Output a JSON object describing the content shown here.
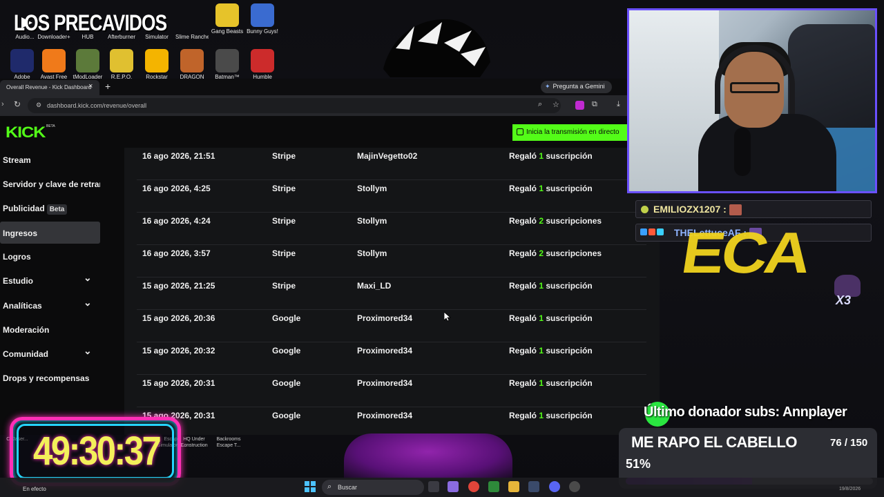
{
  "overlay": {
    "channel_name": "LOS PRECAVIDOS",
    "timer": "49:30:37",
    "donor_text": "Último donador subs: Annplayer",
    "goal": {
      "title": "ME RAPO EL CABELLO",
      "count": "76 / 150",
      "percent_text": "51%",
      "progress": 0.51
    },
    "stylized_text": "ECA",
    "x3_text": "X3"
  },
  "desktop_icons": [
    {
      "label": "Audio...",
      "color": "#2a5bd7"
    },
    {
      "label": "Downloader+",
      "color": "#39b54a"
    },
    {
      "label": "HUB",
      "color": "#3a3a3a"
    },
    {
      "label": "Afterburner",
      "color": "#6b1010"
    },
    {
      "label": "Simulator",
      "color": "#2a2a2a"
    },
    {
      "label": "Slime Rancher",
      "color": "#e64b7a"
    },
    {
      "label": "Gang Beasts",
      "color": "#e6c32a"
    },
    {
      "label": "Bunny Guys!",
      "color": "#3a6bd0"
    },
    {
      "label": "Adobe",
      "color": "#1f2a6b"
    },
    {
      "label": "Avast Free",
      "color": "#f07a1a"
    },
    {
      "label": "tModLoader",
      "color": "#5c7a3a"
    },
    {
      "label": "R.E.P.O.",
      "color": "#e0c030"
    },
    {
      "label": "Rockstar",
      "color": "#f4b400"
    },
    {
      "label": "DRAGON",
      "color": "#c0642a"
    },
    {
      "label": "Batman™",
      "color": "#4a4a4a"
    },
    {
      "label": "Humble",
      "color": "#cc2b2b"
    }
  ],
  "browser": {
    "tab_title": "Overall Revenue - Kick Dashboard",
    "gemini_label": "Pregunta a Gemini",
    "url": "dashboard.kick.com/revenue/overall"
  },
  "kick": {
    "logo": "KICK",
    "logo_sup": "BETA",
    "go_live_label": "Inicia la transmisión en directo"
  },
  "sidebar": {
    "items": [
      {
        "label": "Stream",
        "chevron": false,
        "active": false
      },
      {
        "label": "Servidor y clave de retransmisión",
        "chevron": false,
        "active": false
      },
      {
        "label": "Publicidad",
        "badge": "Beta",
        "chevron": false,
        "active": false
      },
      {
        "label": "Ingresos",
        "chevron": false,
        "active": true
      },
      {
        "label": "Logros",
        "chevron": false,
        "active": false
      },
      {
        "label": "Estudio",
        "chevron": true,
        "active": false
      },
      {
        "label": "Analíticas",
        "chevron": true,
        "active": false
      },
      {
        "label": "Moderación",
        "chevron": false,
        "active": false
      },
      {
        "label": "Comunidad",
        "chevron": true,
        "active": false
      },
      {
        "label": "Drops y recompensas",
        "chevron": false,
        "active": false
      }
    ]
  },
  "revenue_rows": [
    {
      "date": "16 ago 2026, 21:51",
      "method": "Stripe",
      "user": "MajinVegetto02",
      "action_prefix": "Regaló",
      "count": "1",
      "action_suffix": "suscripción"
    },
    {
      "date": "16 ago 2026, 4:25",
      "method": "Stripe",
      "user": "Stollym",
      "action_prefix": "Regaló",
      "count": "1",
      "action_suffix": "suscripción"
    },
    {
      "date": "16 ago 2026, 4:24",
      "method": "Stripe",
      "user": "Stollym",
      "action_prefix": "Regaló",
      "count": "2",
      "action_suffix": "suscripciones"
    },
    {
      "date": "16 ago 2026, 3:57",
      "method": "Stripe",
      "user": "Stollym",
      "action_prefix": "Regaló",
      "count": "2",
      "action_suffix": "suscripciones"
    },
    {
      "date": "15 ago 2026, 21:25",
      "method": "Stripe",
      "user": "Maxi_LD",
      "action_prefix": "Regaló",
      "count": "1",
      "action_suffix": "suscripción"
    },
    {
      "date": "15 ago 2026, 20:36",
      "method": "Google",
      "user": "Proximored34",
      "action_prefix": "Regaló",
      "count": "1",
      "action_suffix": "suscripción"
    },
    {
      "date": "15 ago 2026, 20:32",
      "method": "Google",
      "user": "Proximored34",
      "action_prefix": "Regaló",
      "count": "1",
      "action_suffix": "suscripción"
    },
    {
      "date": "15 ago 2026, 20:31",
      "method": "Google",
      "user": "Proximored34",
      "action_prefix": "Regaló",
      "count": "1",
      "action_suffix": "suscripción"
    },
    {
      "date": "15 ago 2026, 20:31",
      "method": "Google",
      "user": "Proximored34",
      "action_prefix": "Regaló",
      "count": "1",
      "action_suffix": "suscripción"
    }
  ],
  "chat": [
    {
      "user": "EMILIOZX1207 :",
      "color": "#f0e6a0"
    },
    {
      "user": "THELettuceAF :",
      "color": "#8fb4ff"
    }
  ],
  "bottom_icons": [
    {
      "label": "C. Jaser..."
    },
    {
      "label": "A..."
    },
    {
      "label": "Escape Simulator D..."
    },
    {
      "label": "HQ Under Construction"
    },
    {
      "label": "Backrooms Escape T..."
    }
  ],
  "taskbar": {
    "weather": "En efecto",
    "search_placeholder": "Buscar",
    "date": "19/8/2026"
  }
}
